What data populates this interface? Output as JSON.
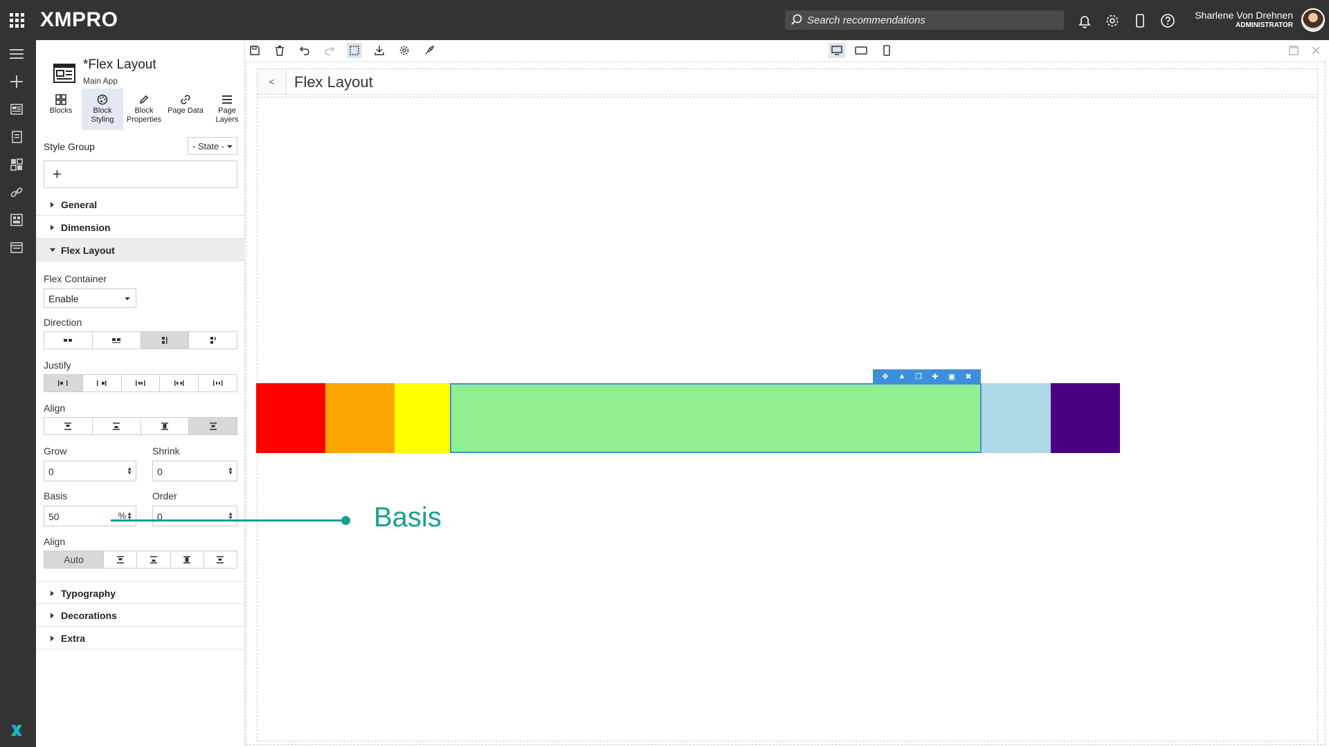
{
  "header": {
    "logo": "XMPRO",
    "search_placeholder": "Search recommendations",
    "user_name": "Sharlene Von Drehnen",
    "user_role": "ADMINISTRATOR"
  },
  "panel": {
    "title": "*Flex Layout",
    "subtitle": "Main App",
    "tabs": [
      {
        "label": "Blocks"
      },
      {
        "label": "Block Styling"
      },
      {
        "label": "Block Properties"
      },
      {
        "label": "Page Data"
      },
      {
        "label": "Page Layers"
      }
    ],
    "style_group_label": "Style Group",
    "state_label": "- State -",
    "add_symbol": "+",
    "sections_top": [
      "General",
      "Dimension",
      "Flex Layout"
    ],
    "flex_container_label": "Flex Container",
    "flex_container_value": "Enable",
    "direction_label": "Direction",
    "justify_label": "Justify",
    "align_label": "Align",
    "grow_label": "Grow",
    "grow_value": "0",
    "shrink_label": "Shrink",
    "shrink_value": "0",
    "basis_label": "Basis",
    "basis_value": "50",
    "basis_unit": "%",
    "order_label": "Order",
    "order_value": "0",
    "align_self_label": "Align",
    "align_self_auto": "Auto",
    "sections_bottom": [
      "Typography",
      "Decorations",
      "Extra"
    ]
  },
  "canvas": {
    "back_label": "<",
    "page_title": "Flex Layout",
    "boxes": [
      {
        "color": "#ff0000"
      },
      {
        "color": "#ffa500"
      },
      {
        "color": "#ffff00"
      },
      {
        "color": "#90ee90"
      },
      {
        "color": "#add8e6"
      },
      {
        "color": "#4b0082"
      }
    ]
  },
  "callout": {
    "text": "Basis",
    "color": "#1a9e8f"
  }
}
